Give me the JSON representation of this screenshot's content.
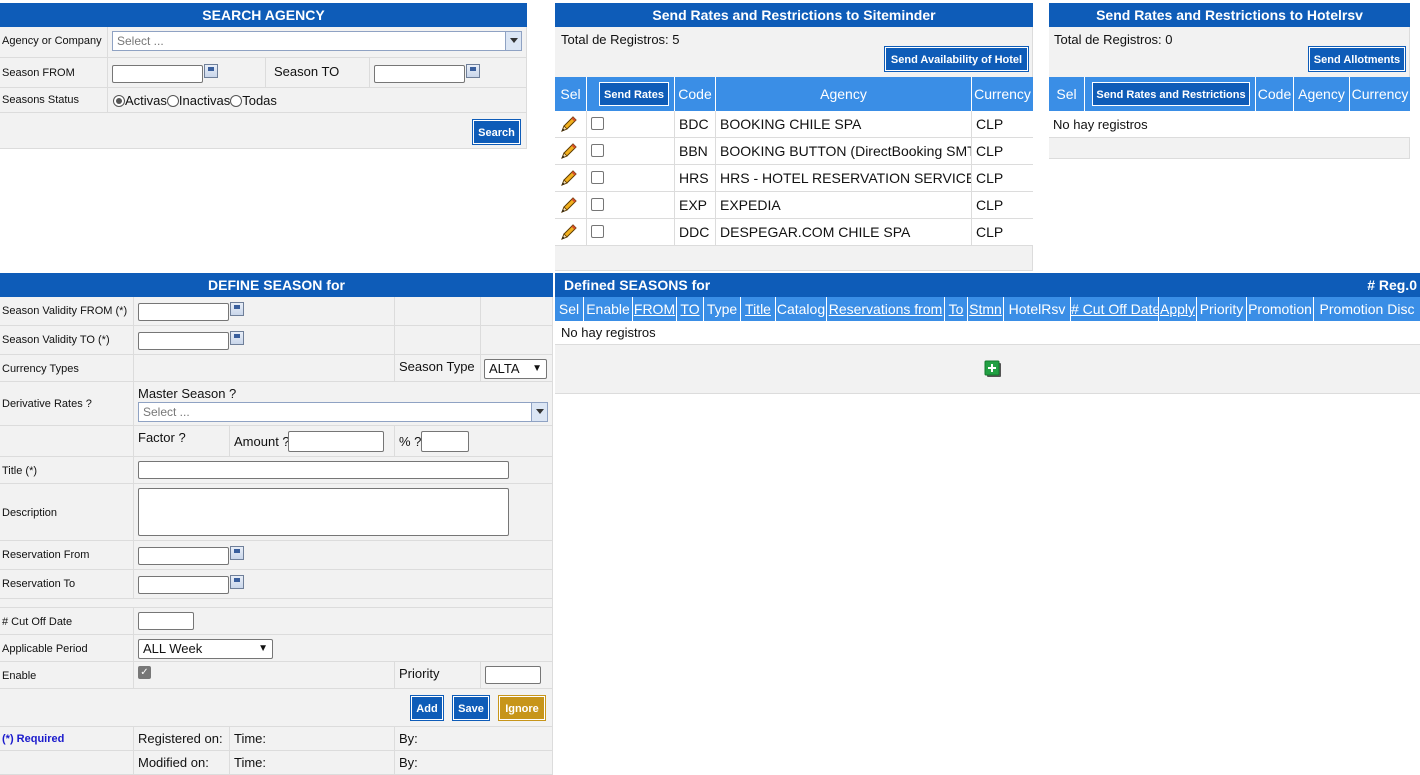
{
  "search_agency": {
    "title": "SEARCH AGENCY",
    "agency_label": "Agency or Company",
    "agency_select": "Select ...",
    "season_from_label": "Season FROM",
    "season_to_label": "Season TO",
    "status_label": "Seasons Status",
    "status_options": [
      "Activas",
      "Inactivas",
      "Todas"
    ],
    "search_button": "Search"
  },
  "siteminder": {
    "title": "Send Rates and Restrictions to Siteminder",
    "total": "Total de Registros: 5",
    "send_availability_button": "Send Availability of Hotel",
    "columns": {
      "sel": "Sel",
      "send_rates": "Send Rates",
      "code": "Code",
      "agency": "Agency",
      "currency": "Currency"
    },
    "rows": [
      {
        "code": "BDC",
        "agency": "BOOKING CHILE SPA",
        "currency": "CLP"
      },
      {
        "code": "BBN",
        "agency": "BOOKING BUTTON (DirectBooking SMTN)",
        "currency": "CLP"
      },
      {
        "code": "HRS",
        "agency": "HRS - HOTEL RESERVATION SERVICE",
        "currency": "CLP"
      },
      {
        "code": "EXP",
        "agency": "EXPEDIA",
        "currency": "CLP"
      },
      {
        "code": "DDC",
        "agency": "DESPEGAR.COM CHILE SPA",
        "currency": "CLP"
      }
    ]
  },
  "hotelrsv": {
    "title": "Send Rates and Restrictions to Hotelrsv",
    "total": "Total de Registros: 0",
    "send_allotments_button": "Send Allotments",
    "columns": {
      "sel": "Sel",
      "send": "Send Rates and Restrictions",
      "code": "Code",
      "agency": "Agency",
      "currency": "Currency"
    },
    "empty": "No hay registros"
  },
  "define_season": {
    "title": "DEFINE SEASON for",
    "validity_from_label": "Season Validity FROM (*)",
    "validity_to_label": "Season Validity TO (*)",
    "currency_types_label": "Currency Types",
    "season_type_label": "Season Type",
    "season_type_value": "ALTA",
    "derivative_label": "Derivative Rates ?",
    "master_season_label": "Master Season ?",
    "master_season_select": "Select ...",
    "factor_label": "Factor ?",
    "amount_label": "Amount ?",
    "percent_label": "% ?",
    "title_label": "Title (*)",
    "description_label": "Description",
    "reservation_from_label": "Reservation From",
    "reservation_to_label": "Reservation To",
    "cutoff_label": "# Cut Off Date",
    "applicable_label": "Applicable Period",
    "applicable_value": "ALL Week",
    "enable_label": "Enable",
    "priority_label": "Priority",
    "add_button": "Add",
    "save_button": "Save",
    "ignore_button": "Ignore",
    "required_note": "(*) Required",
    "registered_label": "Registered on:",
    "modified_label": "Modified on:",
    "time_label": "Time:",
    "by_label": "By:"
  },
  "defined_seasons": {
    "title": "Defined SEASONS for",
    "reg": "# Reg.0",
    "columns": [
      "Sel",
      "Enable",
      "FROM",
      "TO",
      "Type",
      "Title",
      "Catalog",
      "Reservations from",
      "To",
      "Stmn",
      "HotelRsv",
      "# Cut Off Date",
      "Apply",
      "Priority",
      "Promotion",
      "Promotion Disc"
    ],
    "empty": "No hay registros"
  },
  "colors": {
    "header_blue": "#0e5cb8",
    "th_blue": "#3a8ee6",
    "ignore_gold": "#c7951a",
    "required_blue": "#1a1acc"
  }
}
